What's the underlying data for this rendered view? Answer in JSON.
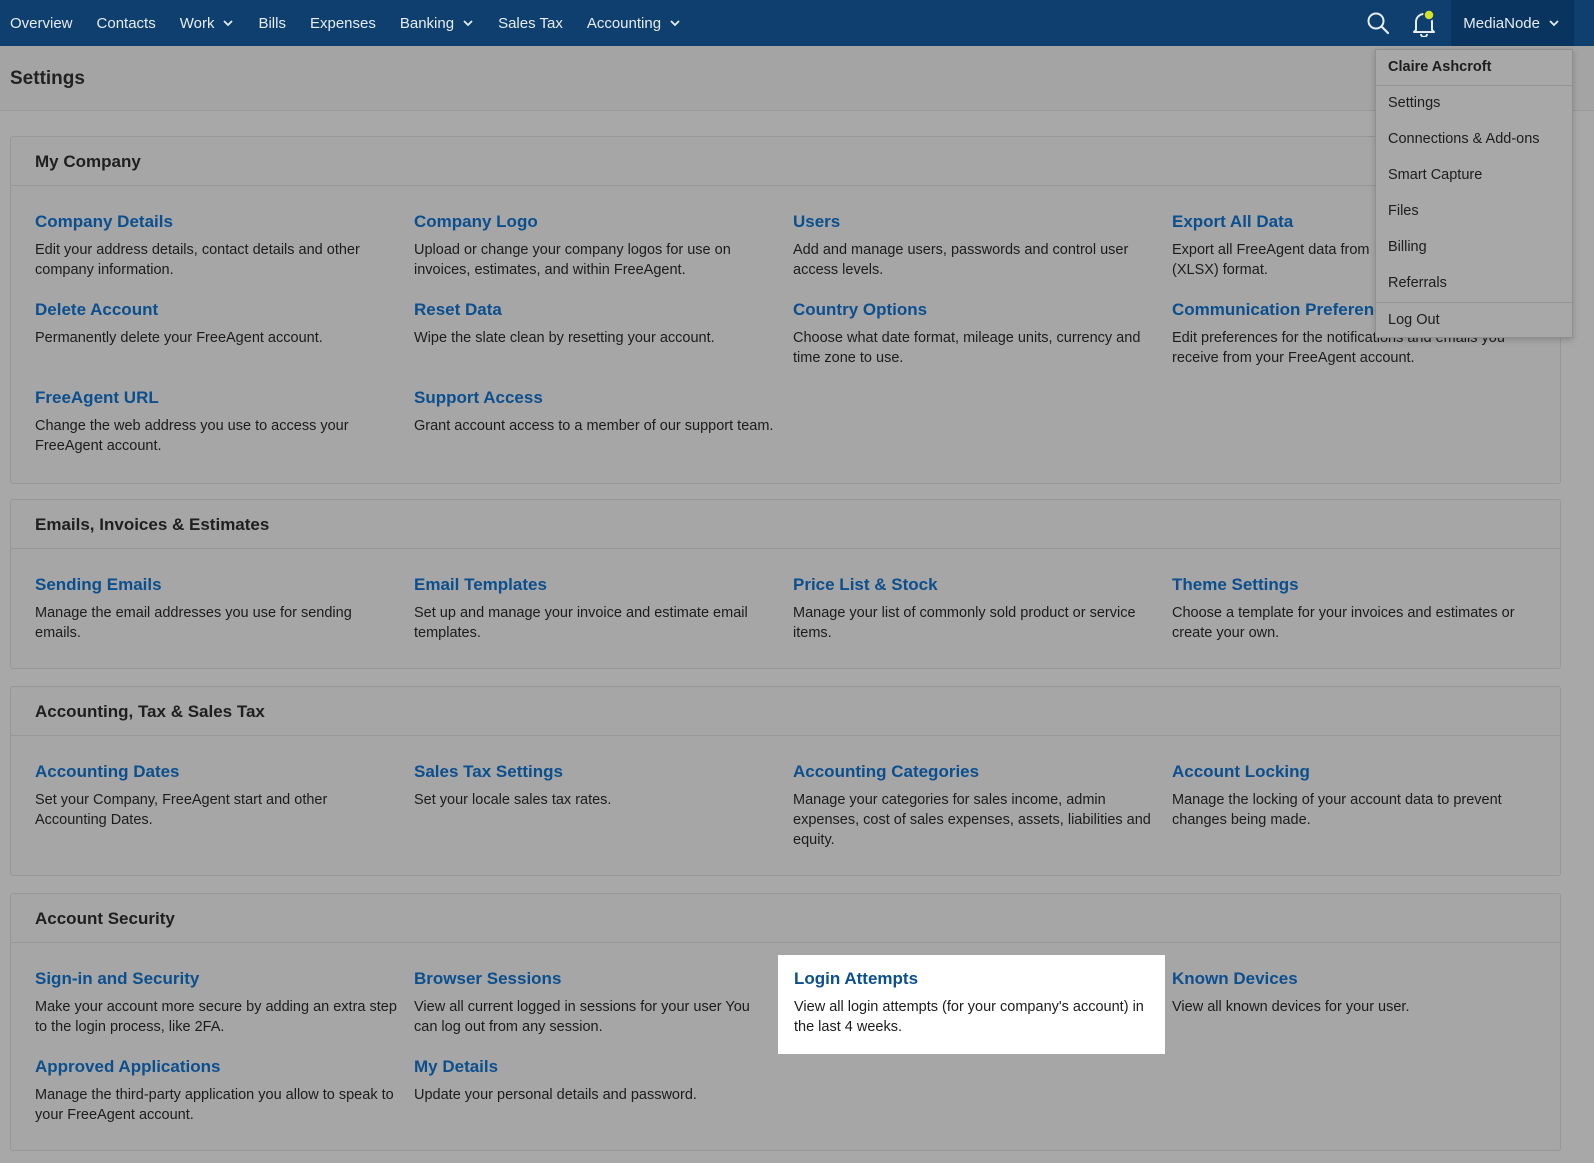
{
  "nav": {
    "items": [
      {
        "label": "Overview",
        "dropdown": false
      },
      {
        "label": "Contacts",
        "dropdown": false
      },
      {
        "label": "Work",
        "dropdown": true
      },
      {
        "label": "Bills",
        "dropdown": false
      },
      {
        "label": "Expenses",
        "dropdown": false
      },
      {
        "label": "Banking",
        "dropdown": true
      },
      {
        "label": "Sales Tax",
        "dropdown": false
      },
      {
        "label": "Accounting",
        "dropdown": true
      }
    ],
    "account_label": "MediaNode",
    "icons": [
      "search-icon",
      "bell-icon",
      "chevron-down-icon"
    ]
  },
  "colors": {
    "topbar": "#0e3f6e",
    "link": "#0b4f8e",
    "notification_dot": "#d6e12a"
  },
  "page": {
    "title": "Settings"
  },
  "dropdown": {
    "user_name": "Claire Ashcroft",
    "items": [
      "Settings",
      "Connections & Add-ons",
      "Smart Capture",
      "Files",
      "Billing",
      "Referrals"
    ],
    "logout": "Log Out"
  },
  "sections": [
    {
      "title": "My Company",
      "items": [
        {
          "title": "Company Details",
          "desc": "Edit your address details, contact details and other company information."
        },
        {
          "title": "Company Logo",
          "desc": "Upload or change your company logos for use on invoices, estimates, and within FreeAgent."
        },
        {
          "title": "Users",
          "desc": "Add and manage users, passwords and control user access levels."
        },
        {
          "title": "Export All Data",
          "desc": "Export all FreeAgent data from (XLSX) format."
        },
        {
          "title": "Delete Account",
          "desc": "Permanently delete your FreeAgent account."
        },
        {
          "title": "Reset Data",
          "desc": "Wipe the slate clean by resetting your account."
        },
        {
          "title": "Country Options",
          "desc": "Choose what date format, mileage units, currency and time zone to use."
        },
        {
          "title": "Communication Preferenc",
          "desc": "Edit preferences for the notifications and emails you receive from your FreeAgent account."
        },
        {
          "title": "FreeAgent URL",
          "desc": "Change the web address you use to access your FreeAgent account."
        },
        {
          "title": "Support Access",
          "desc": "Grant account access to a member of our support team."
        }
      ]
    },
    {
      "title": "Emails, Invoices & Estimates",
      "items": [
        {
          "title": "Sending Emails",
          "desc": "Manage the email addresses you use for sending emails."
        },
        {
          "title": "Email Templates",
          "desc": "Set up and manage your invoice and estimate email templates."
        },
        {
          "title": "Price List & Stock",
          "desc": "Manage your list of commonly sold product or service items."
        },
        {
          "title": "Theme Settings",
          "desc": "Choose a template for your invoices and estimates or create your own."
        }
      ]
    },
    {
      "title": "Accounting, Tax & Sales Tax",
      "items": [
        {
          "title": "Accounting Dates",
          "desc": "Set your Company, FreeAgent start and other Accounting Dates."
        },
        {
          "title": "Sales Tax Settings",
          "desc": "Set your locale sales tax rates."
        },
        {
          "title": "Accounting Categories",
          "desc": "Manage your categories for sales income, admin expenses, cost of sales expenses, assets, liabilities and equity."
        },
        {
          "title": "Account Locking",
          "desc": "Manage the locking of your account data to prevent changes being made."
        }
      ]
    },
    {
      "title": "Account Security",
      "items": [
        {
          "title": "Sign-in and Security",
          "desc": "Make your account more secure by adding an extra step to the login process, like 2FA."
        },
        {
          "title": "Browser Sessions",
          "desc": "View all current logged in sessions for your user You can log out from any session."
        },
        {
          "title": "Login Attempts",
          "desc": "View all login attempts (for your company's account) in the last 4 weeks."
        },
        {
          "title": "Known Devices",
          "desc": "View all known devices for your user."
        },
        {
          "title": "Approved Applications",
          "desc": "Manage the third-party application you allow to speak to your FreeAgent account."
        },
        {
          "title": "My Details",
          "desc": "Update your personal details and password."
        }
      ]
    }
  ]
}
